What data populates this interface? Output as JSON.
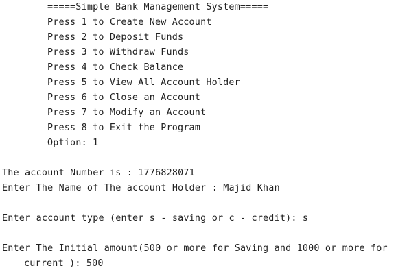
{
  "console": {
    "menu": {
      "header": "=====Simple Bank Management System=====",
      "items": [
        "Press 1 to Create New Account",
        "Press 2 to Deposit Funds",
        "Press 3 to Withdraw Funds",
        "Press 4 to Check Balance",
        "Press 5 to View All Account Holder",
        "Press 6 to Close an Account",
        "Press 7 to Modify an Account",
        "Press 8 to Exit the Program"
      ],
      "option_prompt": "Option: 1"
    },
    "account_number_line": "The account Number is : 1776828071",
    "holder_name_line": "Enter The Name of The account Holder : Majid Khan",
    "account_type_line": "Enter account type (enter s - saving or c - credit): s",
    "initial_amount_line": "Enter The Initial amount(500 or more for Saving and 1000 or more for",
    "initial_amount_continuation": "current ): 500"
  }
}
